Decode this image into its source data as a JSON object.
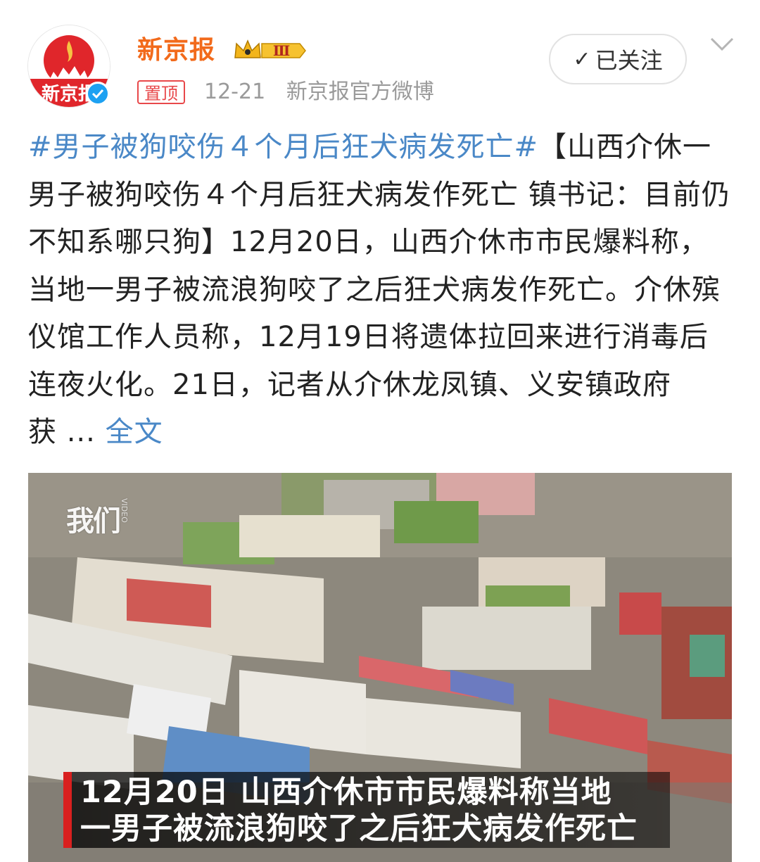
{
  "account": {
    "name": "新京报",
    "avatar_text": "新京报",
    "vip_level": "Ⅲ",
    "pinned_label": "置顶",
    "date": "12-21",
    "source": "新京报官方微博",
    "follow_label": "已关注"
  },
  "post": {
    "hashtag": "#男子被狗咬伤４个月后狂犬病发死亡#",
    "body": "【山西介休一男子被狗咬伤４个月后狂犬病发作死亡 镇书记：目前仍不知系哪只狗】12月20日，山西介休市市民爆料称，当地一男子被流浪狗咬了之后狂犬病发作死亡。介休殡仪馆工作人员称，12月19日将遗体拉回来进行消毒后连夜火化。21日，记者从介休龙凤镇、义安镇政府获",
    "ellipsis": "...",
    "full_text_link": "全文"
  },
  "video": {
    "watermark": "我们",
    "watermark_sub": "VIDEO",
    "caption_line1": "12月20日 山西介休市市民爆料称当地",
    "caption_line2": "一男子被流浪狗咬了之后狂犬病发作死亡"
  },
  "colors": {
    "name_orange": "#f26a1b",
    "link_blue": "#4a88c7",
    "pin_red": "#e8484a",
    "meta_gray": "#9a9a9a",
    "caption_red": "#d9201f"
  },
  "icons": [
    "verified-badge-icon",
    "vip-crown-icon",
    "check-icon",
    "chevron-down-icon"
  ]
}
